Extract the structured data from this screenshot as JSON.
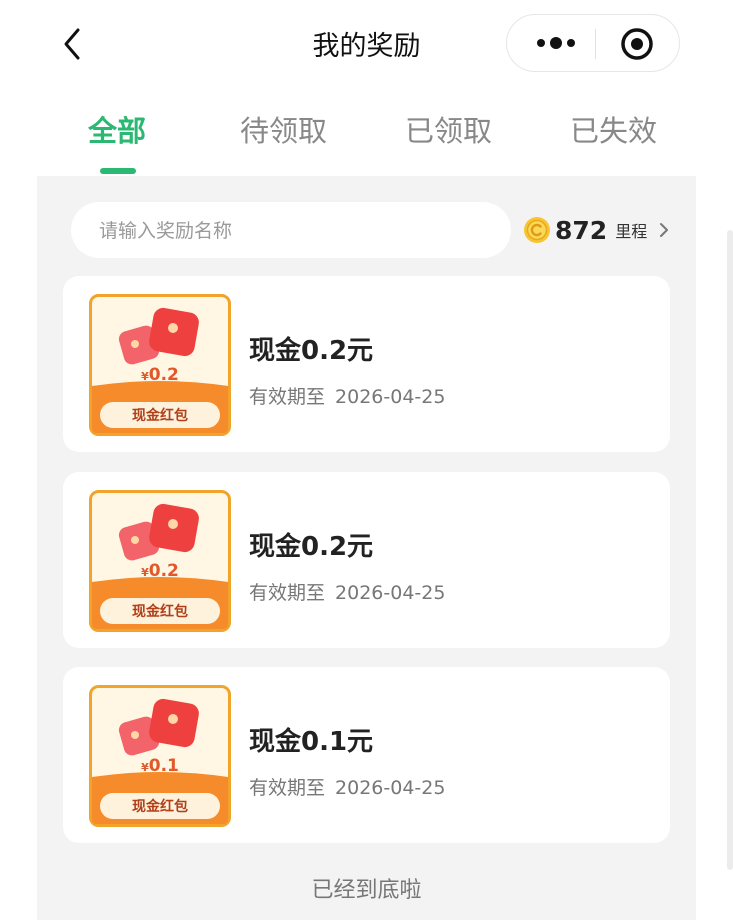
{
  "header": {
    "title": "我的奖励",
    "back_icon": "chevron-left-icon",
    "more_icon": "more-dots-icon",
    "close_icon": "target-close-icon"
  },
  "tabs": [
    {
      "label": "全部",
      "active": true
    },
    {
      "label": "待领取",
      "active": false
    },
    {
      "label": "已领取",
      "active": false
    },
    {
      "label": "已失效",
      "active": false
    }
  ],
  "search": {
    "placeholder": "请输入奖励名称",
    "value": ""
  },
  "points": {
    "value": "872",
    "unit": "里程"
  },
  "rewards": [
    {
      "title": "现金0.2元",
      "badge_amount": "0.2",
      "badge_label": "现金红包",
      "expiry_label": "有效期至",
      "expiry_date": "2026-04-25"
    },
    {
      "title": "现金0.2元",
      "badge_amount": "0.2",
      "badge_label": "现金红包",
      "expiry_label": "有效期至",
      "expiry_date": "2026-04-25"
    },
    {
      "title": "现金0.1元",
      "badge_amount": "0.1",
      "badge_label": "现金红包",
      "expiry_label": "有效期至",
      "expiry_date": "2026-04-25"
    }
  ],
  "footer": {
    "end_text": "已经到底啦"
  },
  "colors": {
    "accent": "#2bb872",
    "coupon_border": "#f0a52a",
    "coupon_orange": "#f58b2a",
    "envelope_red": "#ef4040"
  }
}
